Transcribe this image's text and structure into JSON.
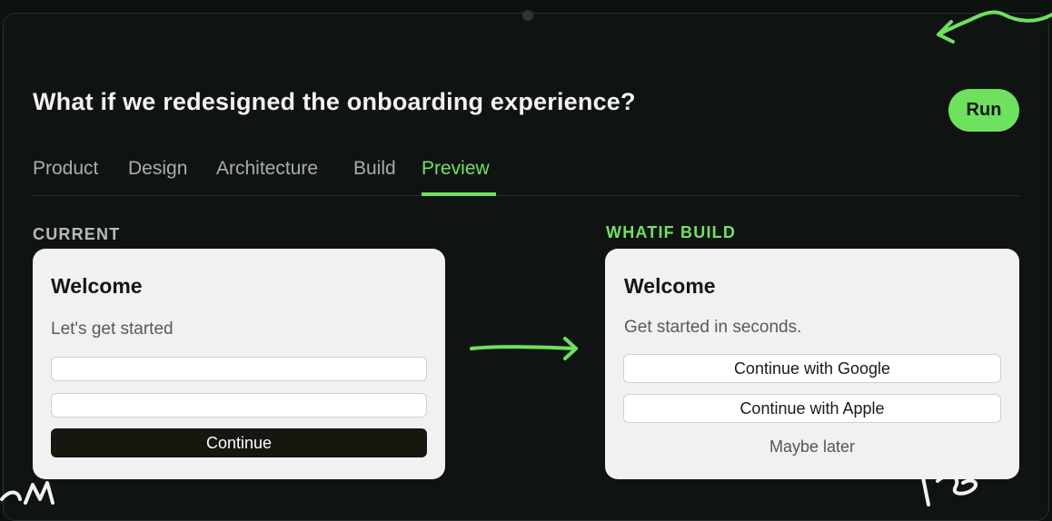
{
  "header": {
    "title": "What if we redesigned the onboarding experience?",
    "run_label": "Run"
  },
  "tabs": [
    {
      "label": "Product",
      "active": false
    },
    {
      "label": "Design",
      "active": false
    },
    {
      "label": "Architecture",
      "active": false
    },
    {
      "label": "Build",
      "active": false
    },
    {
      "label": "Preview",
      "active": true
    }
  ],
  "current": {
    "section_label": "CURRENT",
    "card": {
      "title": "Welcome",
      "subtitle": "Let's get started",
      "continue_label": "Continue"
    }
  },
  "whatif": {
    "section_label": "WHATIF BUILD",
    "card": {
      "title": "Welcome",
      "subtitle": "Get started in seconds.",
      "google_label": "Continue with Google",
      "apple_label": "Continue with Apple",
      "later_label": "Maybe later"
    }
  },
  "colors": {
    "accent": "#73e060",
    "background": "#0f1412",
    "card": "#f1f1f1",
    "primary_button": "#17170f"
  }
}
